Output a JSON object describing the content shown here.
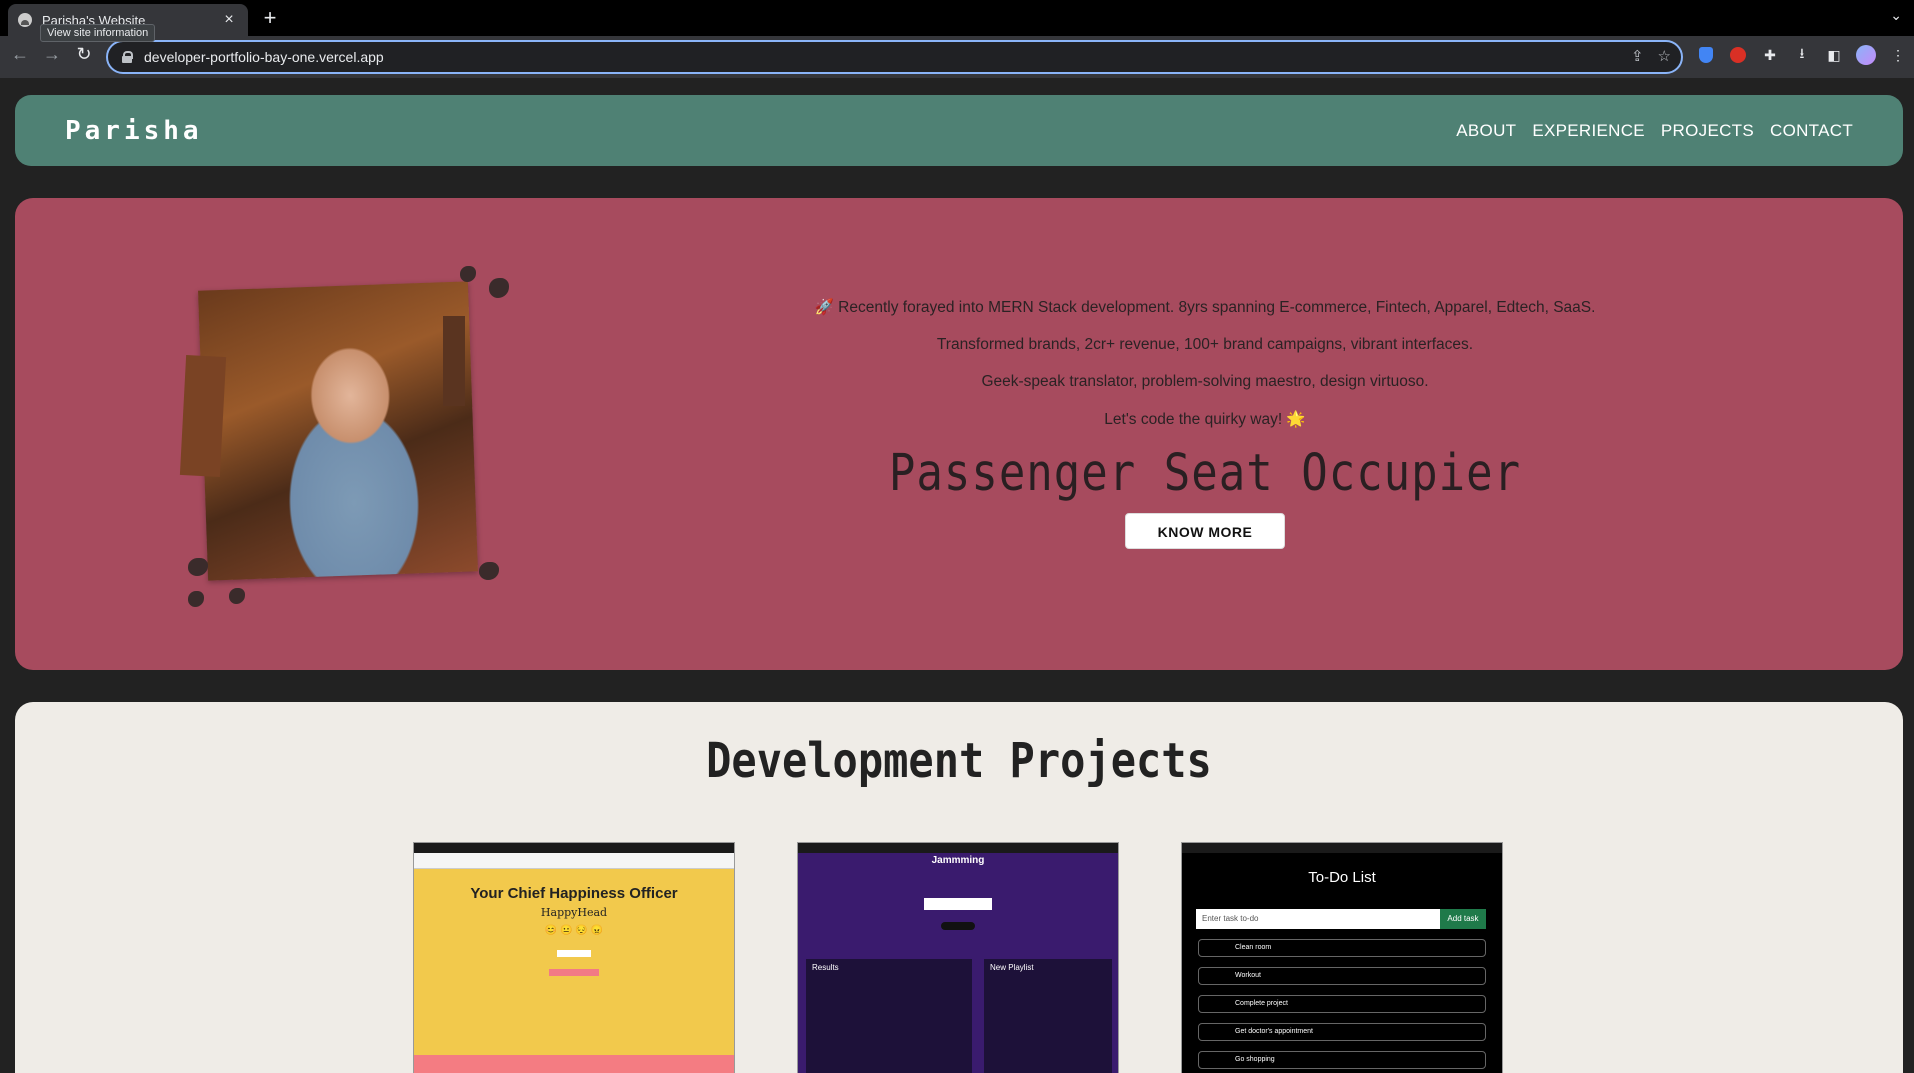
{
  "browser": {
    "tab_title": "Parisha's Website",
    "tab_close": "×",
    "new_tab": "+",
    "tooltip": "View site information",
    "url": "developer-portfolio-bay-one.vercel.app",
    "back": "←",
    "forward": "→",
    "reload": "↻",
    "dropdown": "⌄",
    "share": "⇪",
    "bookmark": "☆",
    "extensions": "✚",
    "download": "⭳",
    "sidepanel": "◧",
    "menu": "⋮"
  },
  "site": {
    "logo": "Parisha",
    "nav": [
      "ABOUT",
      "EXPERIENCE",
      "PROJECTS",
      "CONTACT"
    ],
    "hero": {
      "lines": [
        "🚀 Recently forayed into MERN Stack development. 8yrs spanning E-commerce, Fintech, Apparel, Edtech, SaaS.",
        "Transformed brands, 2cr+ revenue, 100+ brand campaigns, vibrant interfaces.",
        "Geek-speak translator, problem-solving maestro, design virtuoso.",
        "Let's code the quirky way! 🌟"
      ],
      "role": "Passenger Seat Occupier",
      "button": "KNOW MORE"
    },
    "projects": {
      "title": "Development Projects",
      "cards": [
        {
          "heading": "Your Chief Happiness Officer",
          "sub": "HappyHead",
          "faces": "😊 😐 😔 😠"
        },
        {
          "heading": "Jammming",
          "search": "",
          "results": "Results",
          "playlist": "New Playlist"
        },
        {
          "heading": "To-Do List",
          "input_placeholder": "Enter task to-do",
          "add": "Add task",
          "tasks": [
            "Clean room",
            "Workout",
            "Complete project",
            "Get doctor's appointment",
            "Go shopping"
          ]
        }
      ]
    }
  },
  "colors": {
    "nav_bg": "#4f8174",
    "hero_bg": "#a74b5e",
    "projects_bg": "#efece7",
    "page_bg": "#222222"
  }
}
